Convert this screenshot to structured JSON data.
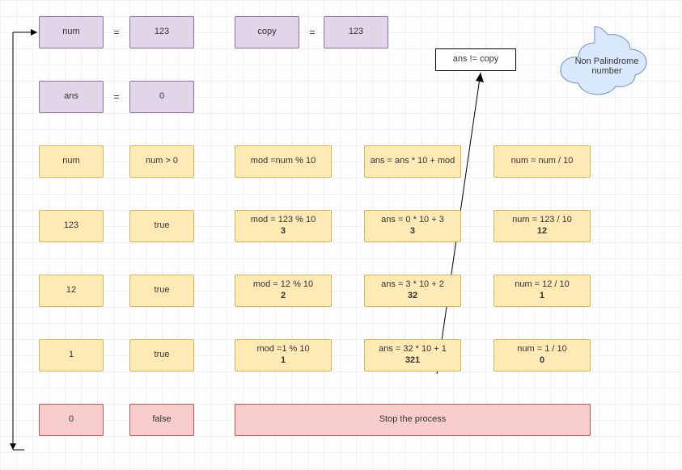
{
  "row0": {
    "num_label": "num",
    "eq1": "=",
    "num_val": "123",
    "copy_label": "copy",
    "eq2": "=",
    "copy_val": "123"
  },
  "row1": {
    "ans_label": "ans",
    "eq": "=",
    "ans_val": "0"
  },
  "compare": "ans  != copy",
  "cloud": "Non Palindrome\nnumber",
  "headers": {
    "c0": "num",
    "c1": "num > 0",
    "c2": "mod =num % 10",
    "c3": "ans = ans * 10 + mod",
    "c4": "num = num / 10"
  },
  "iter1": {
    "c0": "123",
    "c1": "true",
    "c2a": "mod = 123 % 10",
    "c2b": "3",
    "c3a": "ans = 0 * 10 + 3",
    "c3b": "3",
    "c4a": "num = 123 / 10",
    "c4b": "12"
  },
  "iter2": {
    "c0": "12",
    "c1": "true",
    "c2a": "mod = 12 % 10",
    "c2b": "2",
    "c3a": "ans = 3 * 10 + 2",
    "c3b": "32",
    "c4a": "num = 12 / 10",
    "c4b": "1"
  },
  "iter3": {
    "c0": "1",
    "c1": "true",
    "c2a": "mod =1 % 10",
    "c2b": "1",
    "c3a": "ans = 32 * 10 + 1",
    "c3b": "321",
    "c4a": "num = 1 / 10",
    "c4b": "0"
  },
  "end": {
    "c0": "0",
    "c1": "false",
    "stop": "Stop the process"
  },
  "chart_data": {
    "type": "table",
    "title": "Palindrome number check trace (num=123)",
    "columns": [
      "num",
      "num > 0",
      "mod = num % 10",
      "ans = ans*10 + mod",
      "num = num / 10"
    ],
    "rows": [
      [
        123,
        true,
        3,
        3,
        12
      ],
      [
        12,
        true,
        2,
        32,
        1
      ],
      [
        1,
        true,
        1,
        321,
        0
      ],
      [
        0,
        false,
        null,
        null,
        null
      ]
    ],
    "initial": {
      "num": 123,
      "copy": 123,
      "ans": 0
    },
    "result": "Non Palindrome number",
    "condition": "ans != copy"
  }
}
